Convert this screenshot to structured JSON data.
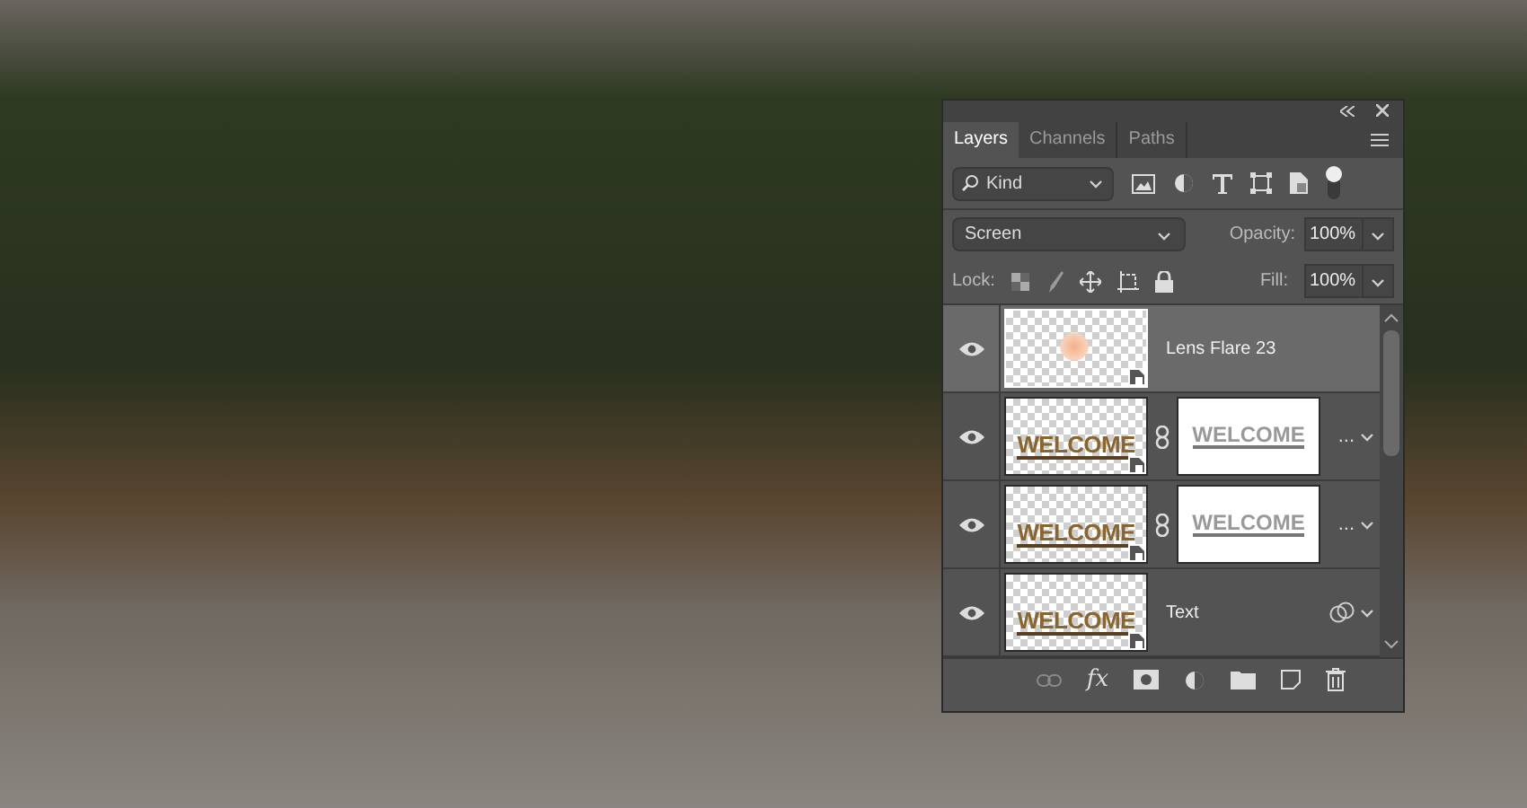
{
  "panel": {
    "tabs": [
      {
        "label": "Layers",
        "selected": true
      },
      {
        "label": "Channels",
        "selected": false
      },
      {
        "label": "Paths",
        "selected": false
      }
    ],
    "filter": {
      "value": "Kind"
    },
    "blend_mode": {
      "value": "Screen"
    },
    "opacity": {
      "label": "Opacity:",
      "value": "100%"
    },
    "lock": {
      "label": "Lock:"
    },
    "fill": {
      "label": "Fill:",
      "value": "100%"
    },
    "layers": [
      {
        "kind": "flare",
        "name": "Lens Flare 23",
        "selected": true,
        "visible": true
      },
      {
        "kind": "masked",
        "thumb_text": "WELCOME",
        "mask_text": "WELCOME",
        "more": "...",
        "selected": false,
        "visible": true
      },
      {
        "kind": "masked",
        "thumb_text": "WELCOME",
        "mask_text": "WELCOME",
        "more": "...",
        "selected": false,
        "visible": true
      },
      {
        "kind": "text",
        "thumb_text": "WELCOME",
        "name": "Text",
        "selected": false,
        "visible": true
      }
    ],
    "footer": {
      "fx": "fx"
    }
  }
}
